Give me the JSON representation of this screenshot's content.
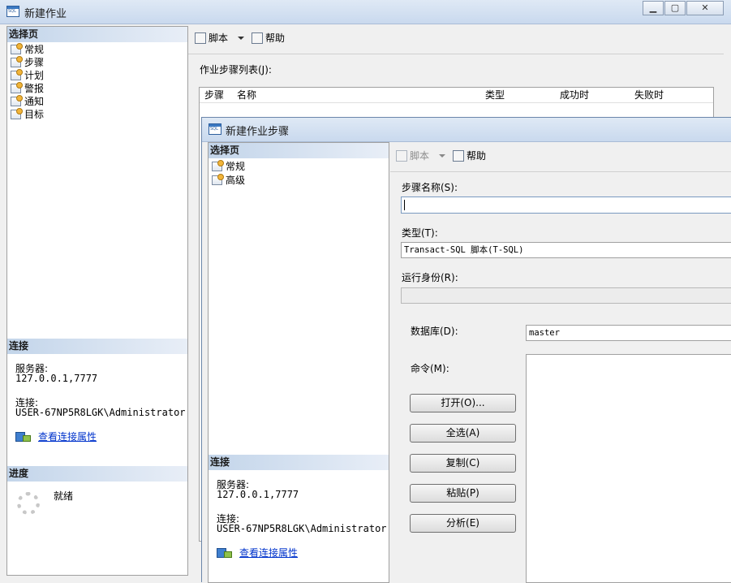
{
  "outer_window": {
    "title": "新建作业",
    "caption_minimize": "▁",
    "caption_maximize": "▢",
    "caption_close": "✕",
    "select_page_header": "选择页",
    "nav_items": [
      "常规",
      "步骤",
      "计划",
      "警报",
      "通知",
      "目标"
    ],
    "connection_header": "连接",
    "server_label": "服务器:",
    "server_value": "127.0.0.1,7777",
    "connection_label": "连接:",
    "connection_value": "USER-67NP5R8LGK\\Administrator",
    "view_connection_link": "查看连接属性",
    "progress_header": "进度",
    "progress_status": "就绪",
    "toolbar": {
      "script_label": "脚本",
      "help_label": "帮助"
    },
    "steps_list_label": "作业步骤列表(J):",
    "steps_columns": [
      "步骤",
      "名称",
      "类型",
      "成功时",
      "失败时"
    ]
  },
  "dialog": {
    "title": "新建作业步骤",
    "select_page_header": "选择页",
    "nav_items": [
      "常规",
      "高级"
    ],
    "connection_header": "连接",
    "server_label": "服务器:",
    "server_value": "127.0.0.1,7777",
    "connection_label": "连接:",
    "connection_value": "USER-67NP5R8LGK\\Administrator",
    "view_connection_link": "查看连接属性",
    "toolbar": {
      "script_label": "脚本",
      "help_label": "帮助"
    },
    "step_name_label": "步骤名称(S):",
    "step_name_value": "",
    "type_label": "类型(T):",
    "type_value": "Transact-SQL 脚本(T-SQL)",
    "run_as_label": "运行身份(R):",
    "run_as_value": "",
    "database_label": "数据库(D):",
    "database_value": "master",
    "command_label": "命令(M):",
    "buttons": {
      "open": "打开(O)...",
      "select_all": "全选(A)",
      "copy": "复制(C)",
      "paste": "粘贴(P)",
      "parse": "分析(E)"
    }
  }
}
